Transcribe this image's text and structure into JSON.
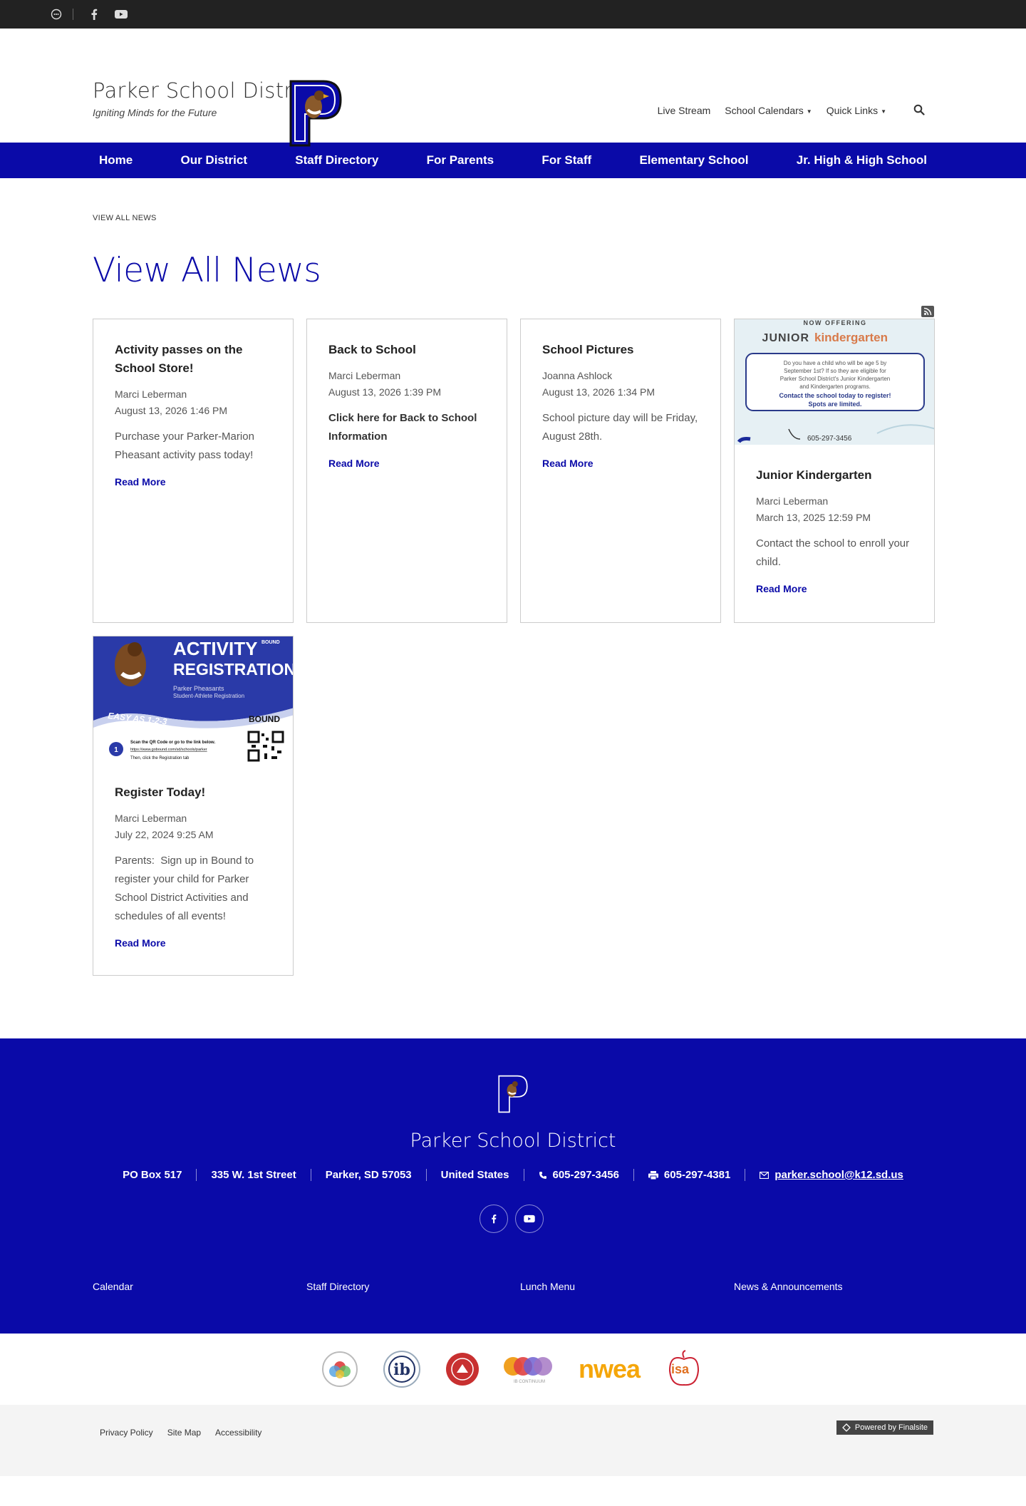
{
  "topbar": {
    "icons": [
      "chat-icon",
      "facebook-icon",
      "youtube-icon"
    ]
  },
  "header": {
    "school_name": "Parker School District",
    "tagline": "Igniting Minds for the Future",
    "utility": {
      "live_stream": "Live Stream",
      "school_calendars": "School Calendars",
      "quick_links": "Quick Links"
    }
  },
  "nav": {
    "items": [
      "Home",
      "Our District",
      "Staff Directory",
      "For Parents",
      "For Staff",
      "Elementary School",
      "Jr. High & High School"
    ]
  },
  "breadcrumb": "VIEW ALL NEWS",
  "page_title": "View All News",
  "news": [
    {
      "title": "Activity passes on the School Store!",
      "author": "Marci Leberman",
      "date": "August 13, 2026 1:46 PM",
      "summary": "Purchase your Parker-Marion Pheasant activity pass today!",
      "read_more": "Read More"
    },
    {
      "title": "Back to School",
      "author": "Marci Leberman",
      "date": "August 13, 2026 1:39 PM",
      "summary": "Click here for Back to School Information",
      "read_more": "Read More"
    },
    {
      "title": "School Pictures",
      "author": "Joanna Ashlock",
      "date": "August 13, 2026 1:34 PM",
      "summary": "School picture day will be Friday, August 28th.",
      "read_more": "Read More"
    },
    {
      "title": "Junior Kindergarten",
      "author": "Marci Leberman",
      "date": "March 13, 2025 12:59 PM",
      "summary": "Contact the school to enroll your child.",
      "read_more": "Read More",
      "image": {
        "kicker": "NOW OFFERING",
        "headline_1": "JUNIOR",
        "headline_2": "kindergarten",
        "line_1": "Do you have a child who will be age 5 by",
        "line_2": "September 1st? If so they are eligible for",
        "line_3": "Parker School District's Junior Kindergarten",
        "line_4": "and Kindergarten programs.",
        "cta_1": "Contact the school today to register!",
        "cta_2": "Spots are limited.",
        "phone": "605-297-3456"
      }
    },
    {
      "title": "Register Today!",
      "author": "Marci Leberman",
      "date": "July 22, 2024 9:25 AM",
      "summary": "Parents:  Sign up in Bound to register your child for Parker School District Activities and schedules of all events!",
      "read_more": "Read More",
      "image": {
        "headline_1": "ACTIVITY",
        "headline_2": "REGISTRATION",
        "sub_1": "Parker Pheasants",
        "sub_2": "Student-Athlete Registration",
        "brand": "BOUND",
        "easy": "EASY AS 1-2-3",
        "step_num": "1",
        "step_text": "Scan the QR Code or go to the link below.",
        "step_link": "https://www.gobound.com/sd/schools/parker",
        "step_more": "Then, click the Registration tab"
      }
    }
  ],
  "footer": {
    "name": "Parker School District",
    "po_box": "PO Box 517",
    "street": "335 W. 1st Street",
    "city": "Parker, SD  57053",
    "country": "United States",
    "phone": "605-297-3456",
    "fax": "605-297-4381",
    "email": "parker.school@k12.sd.us",
    "links": [
      "Calendar",
      "Staff Directory",
      "Lunch Menu",
      "News & Announcements"
    ]
  },
  "partners": {
    "nwea": "nwea",
    "isa": "isa",
    "continuum": "IB CONTINUUM"
  },
  "legal": {
    "links": [
      "Privacy Policy",
      "Site Map",
      "Accessibility"
    ],
    "powered": "Powered by Finalsite"
  },
  "colors": {
    "brand_blue": "#0a0aa8",
    "topbar": "#222222"
  }
}
